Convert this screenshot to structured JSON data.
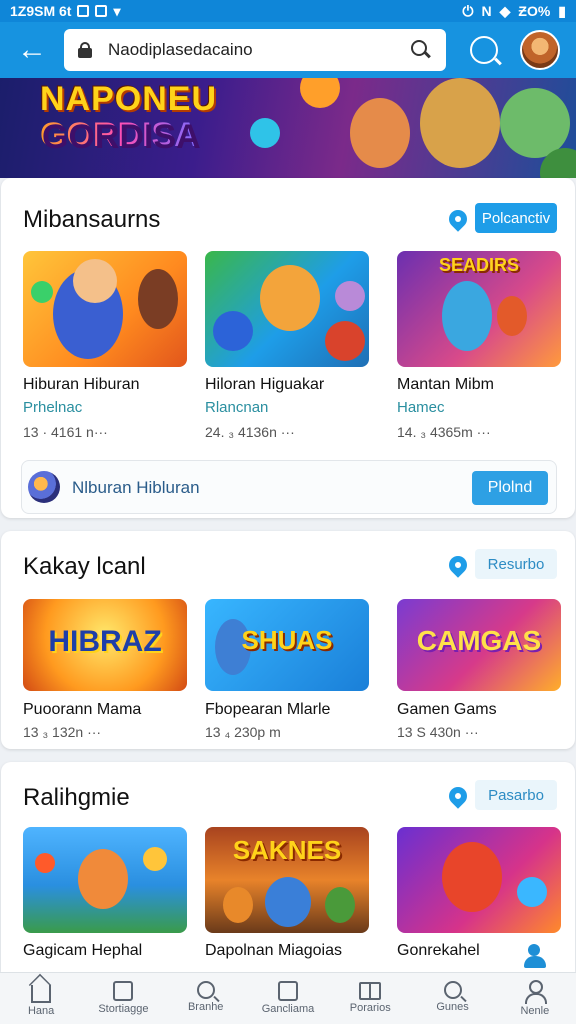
{
  "status_bar": {
    "time": "1Z9SM 6t",
    "battery": "ƵO%"
  },
  "browser": {
    "url": "Naodiplasedacaino"
  },
  "banner": {
    "title": "NAPONEU",
    "subtitle": "GORDISA"
  },
  "sections": [
    {
      "title": "Mibansaurns",
      "action": "Polcanctiv",
      "items": [
        {
          "thumb": "",
          "name": "Hiburan Hiburan",
          "category": "Prhelnac",
          "meta": "13  · 4161 n···"
        },
        {
          "thumb": "",
          "name": "Hiloran Higuakar",
          "category": "Rlancnan",
          "meta": "24. ₃ 4136n ···"
        },
        {
          "thumb": "SEADIRS",
          "name": "Mantan Mibm",
          "category": "Hamec",
          "meta": "14.  ₃ 4365m ···"
        }
      ],
      "promo": {
        "text": "Nlburan Hibluran",
        "button": "Plolnd"
      }
    },
    {
      "title": "Kakay lcanl",
      "action": "Resurbo",
      "items": [
        {
          "thumb": "HIBRAZ",
          "name": "Puoorann Mama",
          "meta": "13  ₃ 132n ···"
        },
        {
          "thumb": "SHUAS",
          "name": "Fbopearan Mlarle",
          "meta": "13  ₄ 230p m"
        },
        {
          "thumb": "CAMGAS",
          "name": "Gamen Gams",
          "meta": "13  S 430n ···"
        }
      ]
    },
    {
      "title": "Ralihgmie",
      "action": "Pasarbo",
      "items": [
        {
          "thumb": "",
          "name": "Gagicam Hephal"
        },
        {
          "thumb": "SAKNES",
          "name": "Dapolnan Miagoias"
        },
        {
          "thumb": "",
          "name": "Gonrekahel"
        }
      ]
    }
  ],
  "nav": [
    {
      "label": "Hana",
      "icon": "home-icon"
    },
    {
      "label": "Stortiagge",
      "icon": "storage-icon"
    },
    {
      "label": "Branhe",
      "icon": "search-icon"
    },
    {
      "label": "Gancliama",
      "icon": "list-icon"
    },
    {
      "label": "Porarios",
      "icon": "book-icon"
    },
    {
      "label": "Gunes",
      "icon": "search-icon"
    },
    {
      "label": "Nenle",
      "icon": "profile-icon"
    }
  ],
  "colors": {
    "primary": "#1793e0",
    "accent": "#1e9de8",
    "category": "#2a8fa0"
  }
}
